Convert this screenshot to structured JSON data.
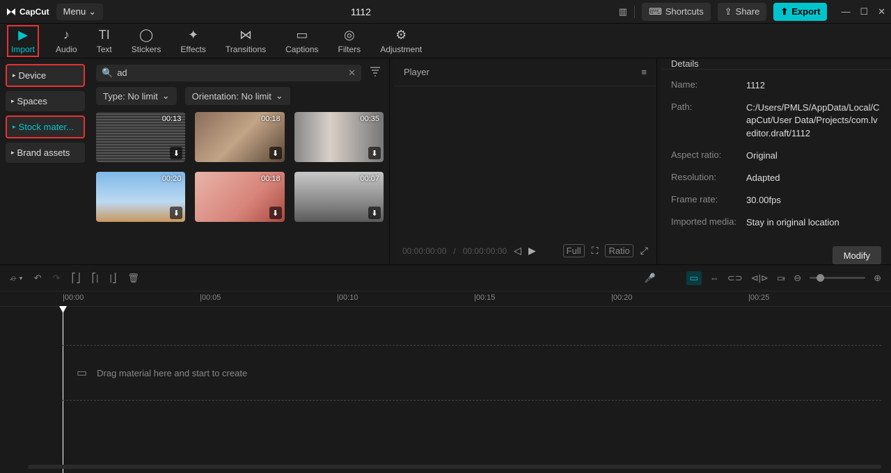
{
  "topbar": {
    "brand": "CapCut",
    "menu": "Menu",
    "title": "1112",
    "shortcuts": "Shortcuts",
    "share": "Share",
    "export": "Export"
  },
  "tabs": [
    {
      "label": "Import",
      "active": true
    },
    {
      "label": "Audio"
    },
    {
      "label": "Text"
    },
    {
      "label": "Stickers"
    },
    {
      "label": "Effects"
    },
    {
      "label": "Transitions"
    },
    {
      "label": "Captions"
    },
    {
      "label": "Filters"
    },
    {
      "label": "Adjustment"
    }
  ],
  "tab_icons": [
    "▶",
    "♪",
    "TI",
    "◯",
    "✦",
    "⋈",
    "▭",
    "◎",
    "⚙"
  ],
  "sidenav": [
    {
      "label": "Device",
      "highlighted": true
    },
    {
      "label": "Spaces"
    },
    {
      "label": "Stock mater...",
      "highlighted": true,
      "active": true
    },
    {
      "label": "Brand assets"
    }
  ],
  "search": {
    "value": "ad"
  },
  "dropdowns": {
    "type": "Type: No limit",
    "orientation": "Orientation: No limit"
  },
  "thumbs": [
    {
      "dur": "00:13",
      "bg": "tb1"
    },
    {
      "dur": "00:18",
      "bg": "tb2"
    },
    {
      "dur": "00:35",
      "bg": "tb3"
    },
    {
      "dur": "00:20",
      "bg": "tb4"
    },
    {
      "dur": "00:18",
      "bg": "tb5"
    },
    {
      "dur": "00:07",
      "bg": "tb6"
    }
  ],
  "player": {
    "title": "Player",
    "time_current": "00:00:00:00",
    "time_total": "00:00:00:00",
    "full": "Full",
    "ratio": "Ratio"
  },
  "details": {
    "title": "Details",
    "rows": [
      {
        "label": "Name:",
        "value": "1112"
      },
      {
        "label": "Path:",
        "value": "C:/Users/PMLS/AppData/Local/CapCut/User Data/Projects/com.lveditor.draft/1112"
      },
      {
        "label": "Aspect ratio:",
        "value": "Original"
      },
      {
        "label": "Resolution:",
        "value": "Adapted"
      },
      {
        "label": "Frame rate:",
        "value": "30.00fps"
      },
      {
        "label": "Imported media:",
        "value": "Stay in original location"
      }
    ],
    "modify": "Modify"
  },
  "timeline": {
    "ticks": [
      "00:00",
      "00:05",
      "00:10",
      "00:15",
      "00:20",
      "00:25"
    ],
    "drop_hint": "Drag material here and start to create"
  }
}
